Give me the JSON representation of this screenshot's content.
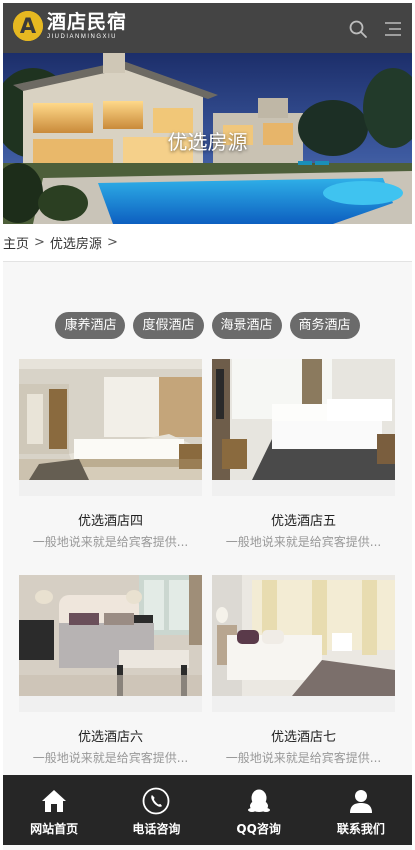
{
  "header": {
    "brand_title": "酒店民宿",
    "brand_subtitle": "JIUDIANMINGXIU",
    "logo_letter": "A",
    "search_icon": "search-icon",
    "menu_icon": "menu-icon"
  },
  "banner": {
    "title": "优选房源"
  },
  "breadcrumb": {
    "home": "主页",
    "sep1": ">",
    "current": "优选房源",
    "sep2": ">"
  },
  "categories": [
    {
      "label": "康养酒店"
    },
    {
      "label": "度假酒店"
    },
    {
      "label": "海景酒店"
    },
    {
      "label": "商务酒店"
    }
  ],
  "products": [
    {
      "name": "优选酒店四",
      "desc": "一般地说来就是给宾客提供..."
    },
    {
      "name": "优选酒店五",
      "desc": "一般地说来就是给宾客提供..."
    },
    {
      "name": "优选酒店六",
      "desc": "一般地说来就是给宾客提供..."
    },
    {
      "name": "优选酒店七",
      "desc": "一般地说来就是给宾客提供..."
    }
  ],
  "bottom_nav": [
    {
      "label": "网站首页",
      "icon": "home-icon"
    },
    {
      "label": "电话咨询",
      "icon": "phone-icon"
    },
    {
      "label": "QQ咨询",
      "icon": "qq-icon"
    },
    {
      "label": "联系我们",
      "icon": "contact-icon"
    }
  ],
  "colors": {
    "header_bg": "#444444",
    "logo_accent": "#e6b821",
    "tab_bg": "#6b6b6b",
    "nav_bg": "#262626"
  }
}
